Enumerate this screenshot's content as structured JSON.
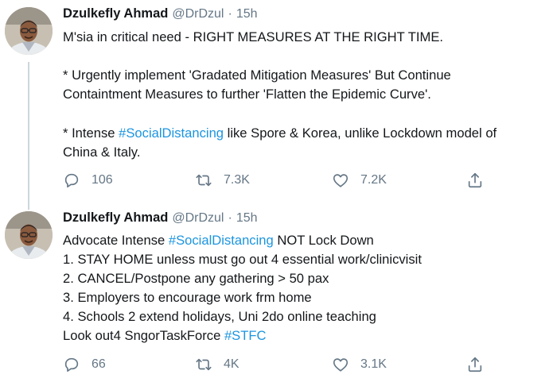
{
  "colors": {
    "link": "#1b95e0",
    "muted": "#657786",
    "text": "#14171a",
    "thread": "#ccd6dd"
  },
  "tweets": [
    {
      "author": "Dzulkefly Ahmad",
      "handle": "@DrDzul",
      "separator": "·",
      "time": "15h",
      "lines": [
        [
          {
            "text": "M'sia in critical need - RIGHT MEASURES AT THE RIGHT TIME."
          }
        ],
        [
          {
            "text": ""
          }
        ],
        [
          {
            "text": "* Urgently implement 'Gradated Mitigation Measures' But Continue"
          }
        ],
        [
          {
            "text": "Containtment Measures to further 'Flatten the Epidemic Curve'."
          }
        ],
        [
          {
            "text": ""
          }
        ],
        [
          {
            "text": "* Intense "
          },
          {
            "text": "#SocialDistancing",
            "hashtag": true
          },
          {
            "text": " like Spore & Korea, unlike Lockdown model of"
          }
        ],
        [
          {
            "text": "China & Italy."
          }
        ]
      ],
      "replies": "106",
      "retweets": "7.3K",
      "likes": "7.2K",
      "icons": {
        "reply": "reply-icon",
        "retweet": "retweet-icon",
        "like": "heart-icon",
        "share": "share-icon"
      }
    },
    {
      "author": "Dzulkefly Ahmad",
      "handle": "@DrDzul",
      "separator": "·",
      "time": "15h",
      "lines": [
        [
          {
            "text": "Advocate Intense "
          },
          {
            "text": "#SocialDistancing",
            "hashtag": true
          },
          {
            "text": " NOT Lock Down"
          }
        ],
        [
          {
            "text": "1. STAY HOME unless must go out 4 essential work/clinicvisit"
          }
        ],
        [
          {
            "text": "2. CANCEL/Postpone any gathering > 50 pax"
          }
        ],
        [
          {
            "text": "3. Employers to encourage work frm home"
          }
        ],
        [
          {
            "text": "4. Schools 2 extend holidays, Uni 2do online teaching"
          }
        ],
        [
          {
            "text": "Look out4 SngorTaskForce "
          },
          {
            "text": "#STFC",
            "hashtag": true
          }
        ]
      ],
      "replies": "66",
      "retweets": "4K",
      "likes": "3.1K",
      "icons": {
        "reply": "reply-icon",
        "retweet": "retweet-icon",
        "like": "heart-icon",
        "share": "share-icon"
      }
    }
  ]
}
